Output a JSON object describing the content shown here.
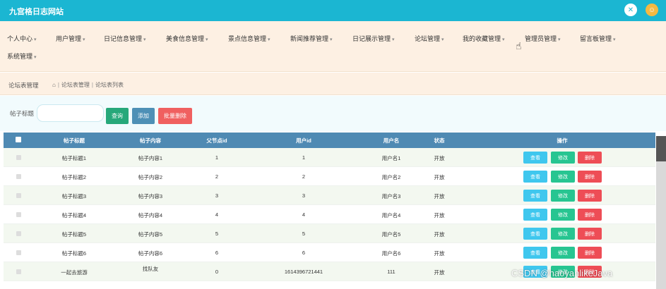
{
  "app": {
    "title": "九宫格日志网站"
  },
  "menu": [
    {
      "label": "个人中心"
    },
    {
      "label": "用户管理"
    },
    {
      "label": "日记信息管理"
    },
    {
      "label": "美食信息管理"
    },
    {
      "label": "景点信息管理"
    },
    {
      "label": "新闻推荐管理"
    },
    {
      "label": "日记展示管理"
    },
    {
      "label": "论坛管理"
    },
    {
      "label": "我的收藏管理"
    },
    {
      "label": "管理员管理"
    },
    {
      "label": "留言板管理"
    },
    {
      "label": "系统管理"
    }
  ],
  "breadcrumb": {
    "page": "论坛表管理",
    "path1": "论坛表管理",
    "path2": "论坛表列表"
  },
  "search": {
    "label": "帖子标题",
    "value": "",
    "search_button": "查询",
    "add_button": "添加",
    "batch_delete_button": "批量删除"
  },
  "table": {
    "headers": [
      "帖子标题",
      "帖子内容",
      "父节点id",
      "用户id",
      "用户名",
      "状态",
      "操作"
    ],
    "rows": [
      {
        "title": "帖子标题1",
        "content": "帖子内容1",
        "parent": "1",
        "uid": "1",
        "uname": "用户名1",
        "status": "开放"
      },
      {
        "title": "帖子标题2",
        "content": "帖子内容2",
        "parent": "2",
        "uid": "2",
        "uname": "用户名2",
        "status": "开放"
      },
      {
        "title": "帖子标题3",
        "content": "帖子内容3",
        "parent": "3",
        "uid": "3",
        "uname": "用户名3",
        "status": "开放"
      },
      {
        "title": "帖子标题4",
        "content": "帖子内容4",
        "parent": "4",
        "uid": "4",
        "uname": "用户名4",
        "status": "开放"
      },
      {
        "title": "帖子标题5",
        "content": "帖子内容5",
        "parent": "5",
        "uid": "5",
        "uname": "用户名5",
        "status": "开放"
      },
      {
        "title": "帖子标题6",
        "content": "帖子内容6",
        "parent": "6",
        "uid": "6",
        "uname": "用户名6",
        "status": "开放"
      },
      {
        "title": "一起去旅游",
        "content": "找队友",
        "parent": "0",
        "uid": "1614396721441",
        "uname": "111",
        "status": "开放"
      }
    ],
    "actions": {
      "view": "查看",
      "edit": "修改",
      "delete": "删除"
    }
  },
  "watermark": "CSDN @haoyanlikeJava",
  "colors": {
    "topbar": "#1bb6d2",
    "menubar": "#fdf0e3",
    "thead": "#4f8ab3",
    "view": "#3fc7ee",
    "edit": "#27c591",
    "delete": "#ee4d56"
  }
}
